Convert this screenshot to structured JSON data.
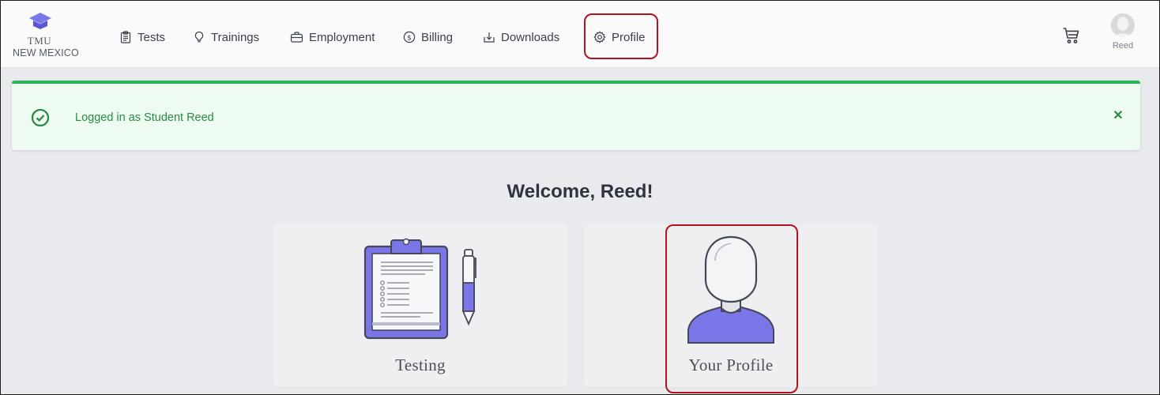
{
  "brand": {
    "name": "TMU",
    "subtitle": "NEW MEXICO",
    "icon": "graduation-cap-icon"
  },
  "nav": {
    "items": [
      {
        "label": "Tests",
        "icon": "clipboard-icon"
      },
      {
        "label": "Trainings",
        "icon": "lightbulb-icon"
      },
      {
        "label": "Employment",
        "icon": "briefcase-icon"
      },
      {
        "label": "Billing",
        "icon": "dollar-circle-icon"
      },
      {
        "label": "Downloads",
        "icon": "download-icon"
      },
      {
        "label": "Profile",
        "icon": "gear-icon"
      }
    ]
  },
  "header_right": {
    "cart_icon": "cart-icon",
    "user_name": "Reed"
  },
  "alert": {
    "message": "Logged in as Student Reed",
    "close_label": "✕",
    "type": "success"
  },
  "welcome": {
    "title": "Welcome, Reed!"
  },
  "cards": [
    {
      "label": "Testing",
      "icon": "clipboard-pen-illustration"
    },
    {
      "label": "Your Profile",
      "icon": "person-bust-illustration"
    }
  ],
  "colors": {
    "accent_purple": "#7b76e8",
    "success_green": "#2cb557",
    "highlight_red": "#b3121f",
    "page_background": "#e9eaed"
  }
}
